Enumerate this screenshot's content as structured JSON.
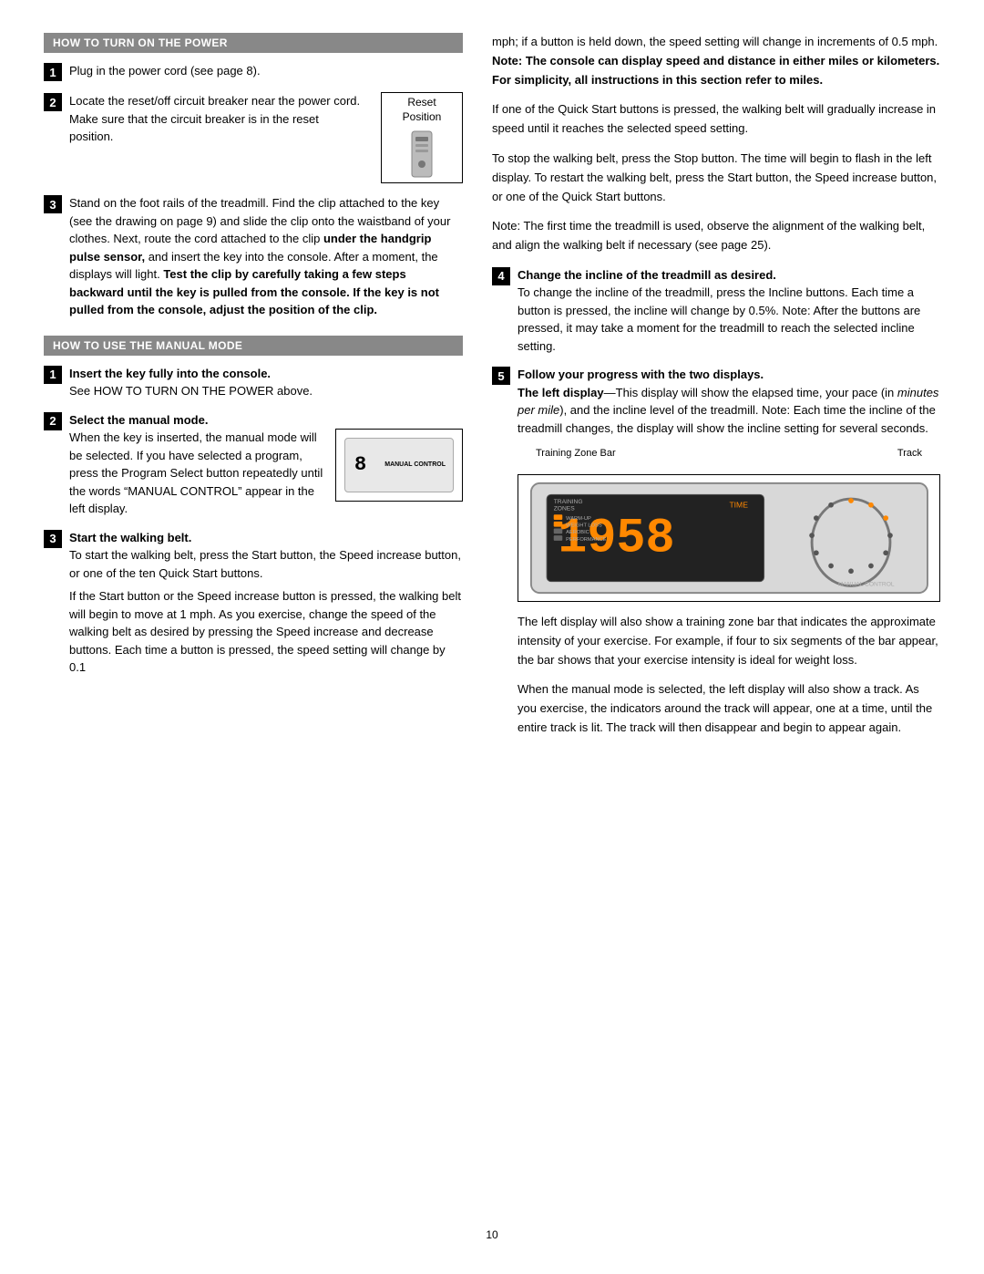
{
  "page": {
    "number": "10"
  },
  "left_col": {
    "section1": {
      "header": "HOW TO TURN ON THE POWER",
      "step1": {
        "num": "1",
        "text": "Plug in the power cord (see page 8)."
      },
      "step2": {
        "num": "2",
        "text_part1": "Locate the reset/off circuit breaker near the power cord. Make sure that the circuit breaker is in the reset position.",
        "reset_label_line1": "Reset",
        "reset_label_line2": "Position"
      },
      "step3": {
        "num": "3",
        "text": "Stand on the foot rails of the treadmill. Find the clip attached to the key (see the drawing on page 9) and slide the clip onto the waistband of your clothes. Next, route the cord attached to the clip ",
        "bold_text": "under the handgrip pulse sensor,",
        "text2": " and insert the key into the console. After a moment, the displays will light. ",
        "bold_text2": "Test the clip by carefully taking a few steps backward until the key is pulled from the console. If the key is not pulled from the console, adjust the position of the clip."
      }
    },
    "section2": {
      "header": "HOW TO USE THE MANUAL MODE",
      "step1": {
        "num": "1",
        "bold_text": "Insert the key fully into the console.",
        "text": "See HOW TO TURN ON THE POWER above."
      },
      "step2": {
        "num": "2",
        "bold_text": "Select the manual mode.",
        "text": "When the key is inserted, the manual mode will be selected. If you have selected a program, press the Program Select button repeatedly until the words “MANUAL CONTROL” appear in the left display.",
        "diagram_time": "8",
        "diagram_label": "MANUAL CONTROL"
      },
      "step3": {
        "num": "3",
        "bold_text": "Start the walking belt.",
        "text1": "To start the walking belt, press the Start button, the Speed increase button, or one of the ten Quick Start buttons.",
        "text2": "If the Start button or the Speed increase button is pressed, the walking belt will begin to move at 1 mph. As you exercise, change the speed of the walking belt as desired by pressing the Speed increase and decrease buttons. Each time a button is pressed, the speed setting will change by 0.1"
      }
    }
  },
  "right_col": {
    "intro_text1": "mph; if a button is held down, the speed setting will change in increments of 0.5 mph. ",
    "intro_bold": "Note: The console can display speed and distance in either miles or kilometers. For simplicity, all instructions in this section refer to miles.",
    "para1": "If one of the Quick Start buttons is pressed, the walking belt will gradually increase in speed until it reaches the selected speed setting.",
    "para2": "To stop the walking belt, press the Stop button. The time will begin to flash in the left display. To restart the walking belt, press the Start button, the Speed increase button, or one of the Quick Start buttons.",
    "para3": "Note: The first time the treadmill is used, observe the alignment of the walking belt, and align the walking belt if necessary (see page 25).",
    "step4": {
      "num": "4",
      "bold_text": "Change the incline of the treadmill as desired.",
      "text": "To change the incline of the treadmill, press the Incline buttons. Each time a button is pressed, the incline will change by 0.5%. Note: After the buttons are pressed, it may take a moment for the treadmill to reach the selected incline setting."
    },
    "step5": {
      "num": "5",
      "bold_text": "Follow your progress with the two displays.",
      "sub_bold": "The left display",
      "sub_text": "—This display will show the elapsed time, your pace (in ",
      "sub_italic": "minutes per mile",
      "sub_text2": "), and the incline level of the treadmill. Note: Each time the incline of the treadmill changes, the display will show the incline setting for several seconds.",
      "diagram": {
        "label_left": "Training Zone Bar",
        "label_right": "Track",
        "big_number": "1958",
        "time_label": "TIME",
        "zones_label": "TRAINING\nZONES",
        "warmup": "WARM-UP",
        "weight_loss": "WEIGHT LOSS",
        "aerobic": "AEROBIC",
        "performance": "PERFORMANCE",
        "manual_control": "MANUAL CONTROL"
      },
      "para_after1": "The left display will also show a training zone bar that indicates the approximate intensity of your exercise. For example, if four to six segments of the bar appear, the bar shows that your exercise intensity is ideal for weight loss.",
      "para_after2": "When the manual mode is selected, the left display will also show a track. As you exercise, the indicators around the track will appear, one at a time, until the entire track is lit. The track will then disappear and begin to appear again."
    }
  }
}
